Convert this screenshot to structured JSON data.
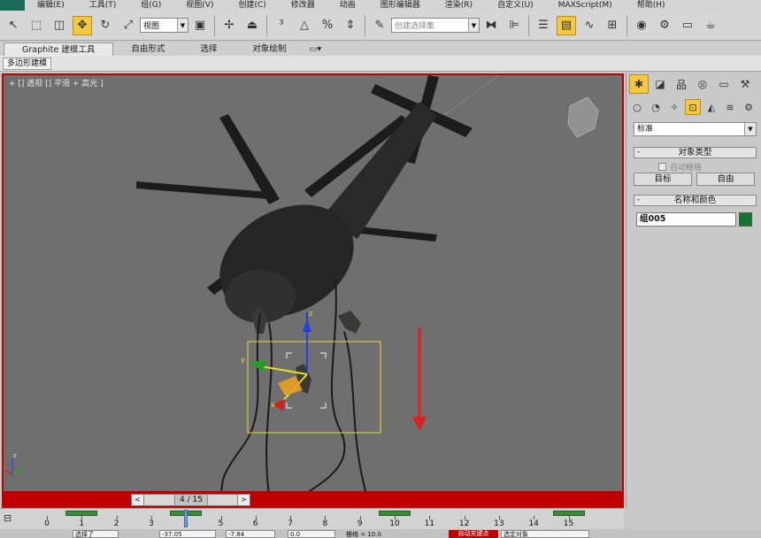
{
  "menubar": {
    "items": [
      "编辑(E)",
      "工具(T)",
      "组(G)",
      "视图(V)",
      "创建(C)",
      "修改器",
      "动画",
      "图形编辑器",
      "渲染(R)",
      "自定义(U)",
      "MAXScript(M)",
      "帮助(H)"
    ]
  },
  "toolbar": {
    "view_select": "视图",
    "named_selection_placeholder": "创建选择集",
    "icons": [
      "select-icon",
      "region-icon",
      "window-crossing-icon",
      "move-icon",
      "rotate-icon",
      "scale-icon",
      "pivot-icon",
      "snap-icon",
      "angle-snap-icon",
      "percent-snap-icon",
      "spinner-snap-icon",
      "edit-named-selection-icon",
      "mirror-icon",
      "align-icon",
      "layer-icon",
      "graphite-toggle-icon",
      "curve-editor-icon",
      "schematic-icon",
      "material-editor-icon",
      "render-setup-icon",
      "render-frame-icon",
      "render-icon"
    ]
  },
  "ribbon": {
    "tabs": [
      "Graphite 建模工具",
      "自由形式",
      "选择",
      "对象绘制"
    ],
    "active_tab": "Graphite 建模工具",
    "subtab": "多边形建模"
  },
  "viewport": {
    "label": "+ [] 透视 [] 平滑 + 高光 ]",
    "active_border_color": "#c00000"
  },
  "timeslider": {
    "prev": "<",
    "next": ">",
    "position": "4 / 15",
    "current_frame": 4,
    "total_frames": 15
  },
  "trackbar": {
    "ticks": [
      "0",
      "1",
      "2",
      "3",
      "4",
      "5",
      "6",
      "7",
      "8",
      "9",
      "10",
      "11",
      "12",
      "13",
      "14",
      "15"
    ],
    "keyframes": [
      1,
      4,
      10,
      15
    ]
  },
  "statusbar": {
    "selection": "选择了",
    "x": "-37.05",
    "y": "-7.84",
    "z": "0.0",
    "grid": "栅格 = 10.0",
    "autokey": "自动关键点",
    "selected_set": "选定对象"
  },
  "cmdpanel": {
    "category": "标准",
    "object_type_title": "对象类型",
    "autogrid": "自动栅格",
    "btn_target": "目标",
    "btn_free": "自由",
    "name_color_title": "名称和颜色",
    "object_name": "组005",
    "object_color": "#0f7a2e"
  }
}
